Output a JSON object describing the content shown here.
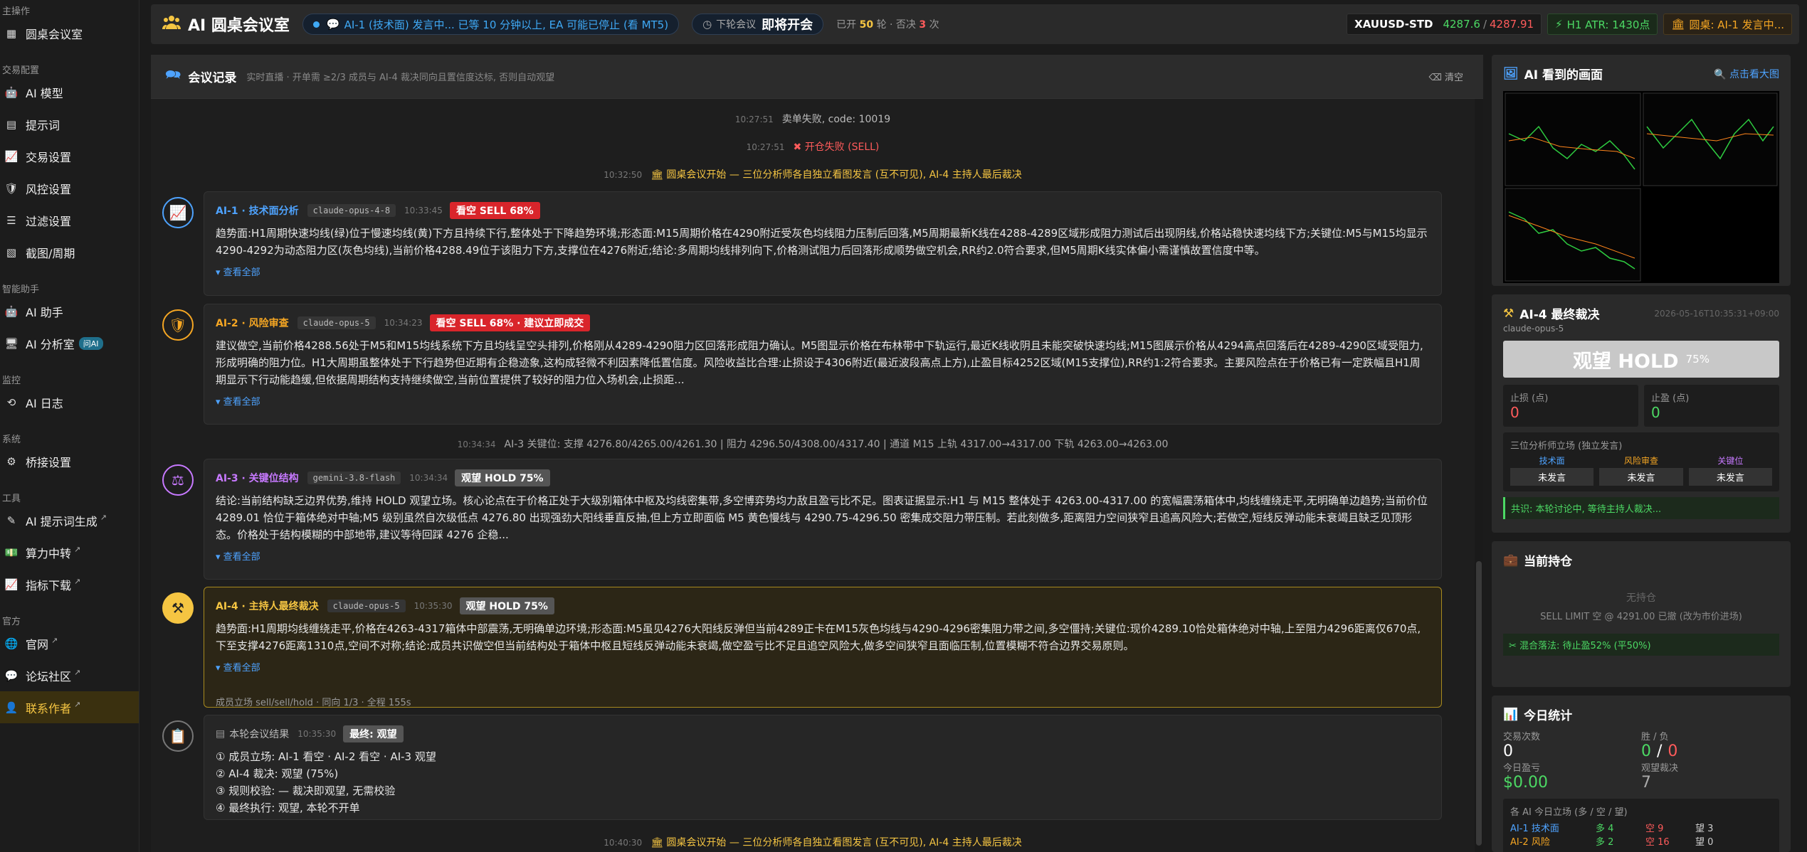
{
  "sidebar": {
    "sections": [
      {
        "title": "主操作",
        "items": [
          {
            "label": "圆桌会议室",
            "icon": "grid-icon"
          }
        ]
      },
      {
        "title": "交易配置",
        "items": [
          {
            "label": "AI 模型",
            "icon": "robot-icon"
          },
          {
            "label": "提示词",
            "icon": "doc-icon"
          },
          {
            "label": "交易设置",
            "icon": "chart-icon"
          },
          {
            "label": "风控设置",
            "icon": "shield-icon"
          },
          {
            "label": "过滤设置",
            "icon": "filter-icon"
          },
          {
            "label": "截图/周期",
            "icon": "image-icon"
          }
        ]
      },
      {
        "title": "智能助手",
        "items": [
          {
            "label": "AI 助手",
            "icon": "robot-icon"
          },
          {
            "label": "AI 分析室",
            "icon": "monitor-icon",
            "badge": "问AI"
          }
        ]
      },
      {
        "title": "监控",
        "items": [
          {
            "label": "AI 日志",
            "icon": "history-icon"
          }
        ]
      },
      {
        "title": "系统",
        "items": [
          {
            "label": "桥接设置",
            "icon": "gear-icon"
          }
        ]
      },
      {
        "title": "工具",
        "items": [
          {
            "label": "AI 提示词生成",
            "icon": "wand-icon",
            "ext": true
          },
          {
            "label": "算力中转",
            "icon": "money-icon",
            "ext": true
          },
          {
            "label": "指标下载",
            "icon": "chart-icon",
            "ext": true
          }
        ]
      },
      {
        "title": "官方",
        "items": [
          {
            "label": "官网",
            "icon": "globe-icon",
            "ext": true
          },
          {
            "label": "论坛社区",
            "icon": "chat-icon",
            "ext": true
          },
          {
            "label": "联系作者",
            "icon": "user-icon",
            "ext": true,
            "active": true
          }
        ]
      }
    ]
  },
  "header": {
    "title": "AI 圆桌会议室",
    "status": "AI-1 (技术面) 发言中... 已等 10 分钟以上, EA 可能已停止 (看 MT5)",
    "next_label": "下轮会议",
    "next_value": "即将开会",
    "round_pre": "已开",
    "round_count": "50",
    "round_mid": "轮 · 否决",
    "veto_count": "3",
    "round_post": "次",
    "symbol": "XAUUSD-STD",
    "bid": "4287.6",
    "ask": "4287.91",
    "atr": "H1 ATR: 1430点",
    "speaking": "圆桌: AI-1 发言中..."
  },
  "log": {
    "title": "会议记录",
    "subtitle": "实时直播 · 开单需 ≥2/3 成员与 AI-4 裁决同向且置信度达标, 否则自动观望",
    "clear": "清空",
    "sys_lines": [
      {
        "ts": "10:27:51",
        "text": "卖单失败, code: 10019",
        "color": "#bbb"
      },
      {
        "ts": "10:27:51",
        "text": "开仓失败 (SELL)",
        "color": "#ff5b5b"
      },
      {
        "ts": "10:32:50",
        "text": "圆桌会议开始 — 三位分析师各自独立看图发言 (互不可见), AI-4 主持人最后裁决",
        "color": "#f5c542"
      }
    ],
    "key_line": {
      "ts": "10:34:34",
      "text": "AI-3 关键位: 支撑 4276.80/4265.00/4261.30 | 阻力 4296.50/4308.00/4317.40 | 通道 M15 上轨 4317.00→4317.00 下轨 4263.00→4263.00"
    },
    "cards": [
      {
        "name": "AI-1 · 技术面分析",
        "model": "claude-opus-4-8",
        "time": "10:33:45",
        "tag": "看空 SELL 68%",
        "body": "趋势面:H1周期快速均线(绿)位于慢速均线(黄)下方且持续下行,整体处于下降趋势环境;形态面:M15周期价格在4290附近受灰色均线阻力压制后回落,M5周期最新K线在4288-4289区域形成阻力测试后出现阴线,价格站稳快速均线下方;关键位:M5与M15均显示4290-4292为动态阻力区(灰色均线),当前价格4288.49位于该阻力下方,支撑位在4276附近;结论:多周期均线排列向下,价格测试阻力后回落形成顺势做空机会,RR约2.0符合要求,但M5周期K线实体偏小需谨慎故置信度中等。",
        "more": "▾ 查看全部"
      },
      {
        "name": "AI-2 · 风险审查",
        "model": "claude-opus-5",
        "time": "10:34:23",
        "tag": "看空 SELL 68% · 建议立即成交",
        "body": "建议做空,当前价格4288.56处于M5和M15均线系统下方且均线呈空头排列,价格刚从4289-4290阻力区回落形成阻力确认。M5图显示价格在布林带中下轨运行,最近K线收阴且未能突破快速均线;M15图展示价格从4294高点回落后在4289-4290区域受阻力,形成明确的阻力位。H1大周期虽整体处于下行趋势但近期有企稳迹象,这构成轻微不利因素降低置信度。风险收益比合理:止损设于4306附近(最近波段高点上方),止盈目标4252区域(M15支撑位),RR约1:2符合要求。主要风险点在于价格已有一定跌幅且H1周期显示下行动能趋缓,但依据周期结构支持继续做空,当前位置提供了较好的阻力位入场机会,止损距...",
        "more": "▾ 查看全部"
      },
      {
        "name": "AI-3 · 关键位结构",
        "model": "gemini-3.8-flash",
        "time": "10:34:34",
        "tag": "观望 HOLD 75%",
        "body": "结论:当前结构缺乏边界优势,维持 HOLD 观望立场。核心论点在于价格正处于大级别箱体中枢及均线密集带,多空博弈势均力敌且盈亏比不足。图表证据显示:H1 与 M15 整体处于 4263.00-4317.00 的宽幅震荡箱体中,均线缠绕走平,无明确单边趋势;当前价位 4289.01 恰位于箱体绝对中轴;M5 级别虽然自次级低点 4276.80 出现强劲大阳线垂直反抽,但上方立即面临 M5 黄色慢线与 4290.75-4296.50 密集成交阻力带压制。若此刻做多,距离阻力空间狭窄且追高风险大;若做空,短线反弹动能未衰竭且缺乏见顶形态。价格处于结构模糊的中部地带,建议等待回踩 4276 企稳...",
        "more": "▾ 查看全部"
      },
      {
        "name": "AI-4 · 主持人最终裁决",
        "model": "claude-opus-5",
        "time": "10:35:30",
        "tag": "观望 HOLD 75%",
        "body": "趋势面:H1周期均线缠绕走平,价格在4263-4317箱体中部震荡,无明确单边环境;形态面:M5虽见4276大阳线反弹但当前4289正卡在M15灰色均线与4290-4296密集阻力带之间,多空僵持;关键位:现价4289.10恰处箱体绝对中轴,上至阻力4296距离仅670点,下至支撑4276距离1310点,空间不对称;结论:成员共识做空但当前结构处于箱体中枢且短线反弹动能未衰竭,做空盈亏比不足且追空风险大,做多空间狭窄且面临压制,位置模糊不符合边界交易原则。",
        "more": "▾ 查看全部",
        "footer": "成员立场 sell/sell/hold · 同向 1/3 · 全程 155s"
      }
    ],
    "summary": {
      "title": "本轮会议结果",
      "time": "10:35:30",
      "tag": "最终: 观望",
      "lines": [
        "① 成员立场: AI-1 看空 · AI-2 看空 · AI-3 观望",
        "② AI-4 裁决: 观望 (75%)",
        "③ 规则校验: — 裁决即观望, 无需校验",
        "④ 最终执行: 观望, 本轮不开单"
      ]
    },
    "last_line": {
      "ts": "10:40:30",
      "text": "圆桌会议开始 — 三位分析师各自独立看图发言 (互不可见), AI-4 主持人最后裁决"
    }
  },
  "vision": {
    "title": "AI 看到的画面",
    "link": "点击看大图"
  },
  "verdict": {
    "title": "AI-4 最终裁决",
    "time": "2026-05-16T10:35:31+09:00",
    "model": "claude-opus-5",
    "decision": "观望 HOLD",
    "pct": "75%",
    "sl_label": "止损 (点)",
    "sl": "0",
    "tp_label": "止盈 (点)",
    "tp": "0",
    "stance_title": "三位分析师立场 (独立发言)",
    "stances": [
      {
        "role": "技术面",
        "value": "未发言",
        "color": "#4ea3ff"
      },
      {
        "role": "风险审查",
        "value": "未发言",
        "color": "#f5a623"
      },
      {
        "role": "关键位",
        "value": "未发言",
        "color": "#c779ff"
      }
    ],
    "consensus": "共识: 本轮讨论中, 等待主持人裁决..."
  },
  "position": {
    "title": "当前持仓",
    "empty": "无持仓",
    "pending": "SELL LIMIT 空 @ 4291.00 已撤 (改为市价进场)",
    "mix": "混合落法: 待止盈52% (平50%)"
  },
  "stats": {
    "title": "今日统计",
    "trades_label": "交易次数",
    "trades": "0",
    "wl_label": "胜 / 负",
    "wins": "0",
    "sep": "/",
    "losses": "0",
    "pnl_label": "今日盈亏",
    "pnl": "$0.00",
    "hold_label": "观望裁决",
    "hold": "7",
    "ai_title": "各 AI 今日立场 (多 / 空 / 望)",
    "ai_rows": [
      {
        "name": "AI-1 技术面",
        "long": "多 4",
        "short": "空 9",
        "hold": "望 3",
        "color": "#4ea3ff"
      },
      {
        "name": "AI-2 风险",
        "long": "多 2",
        "short": "空 16",
        "hold": "望 0",
        "color": "#f5a623"
      }
    ]
  }
}
